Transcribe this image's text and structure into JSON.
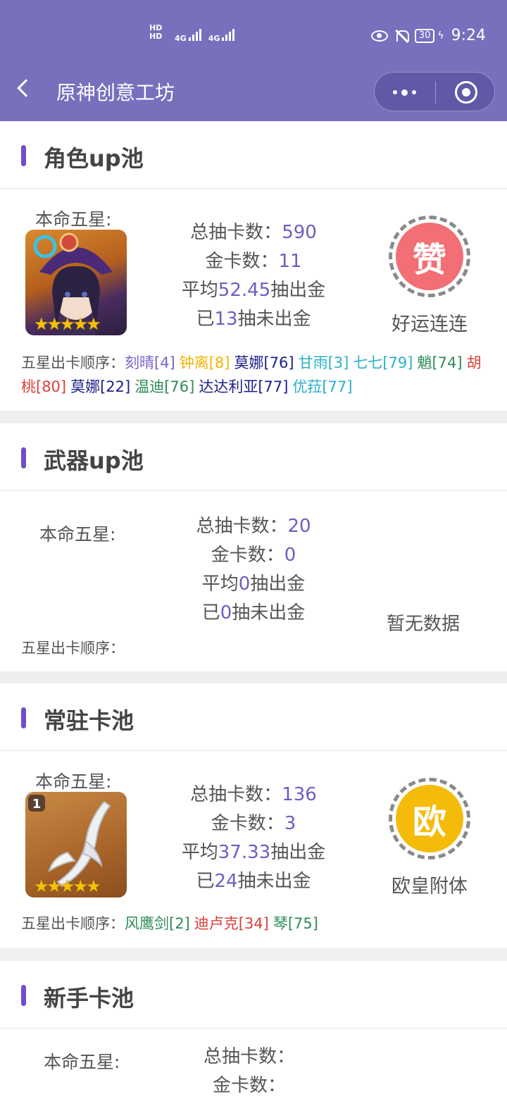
{
  "status_bar": {
    "hd1": "HD",
    "hd2": "HD",
    "net1": "4G",
    "net2": "4G",
    "battery": "30",
    "time": "9:24"
  },
  "nav": {
    "title": "原神创意工坊"
  },
  "labels": {
    "benming": "本命五星:",
    "total_prefix": "总抽卡数：",
    "gold_prefix": "金卡数：",
    "avg_prefix": "平均",
    "avg_suffix": "抽出金",
    "since_prefix": "已",
    "since_suffix": "抽未出金",
    "order_prefix": "五星出卡顺序："
  },
  "pools": [
    {
      "title": "角色up池",
      "total": "590",
      "gold": "11",
      "avg": "52.45",
      "since": "13",
      "badge_char": "赞",
      "badge_color": "#f26f75",
      "badge_caption": "好运连连",
      "order": [
        {
          "text": "刻晴[4]",
          "color": "#7b64c8"
        },
        {
          "text": "钟离[8]",
          "color": "#f0b400"
        },
        {
          "text": "莫娜[76]",
          "color": "#1c1f8a"
        },
        {
          "text": "甘雨[3]",
          "color": "#27b0c8"
        },
        {
          "text": "七七[79]",
          "color": "#27b0c8"
        },
        {
          "text": "魈[74]",
          "color": "#2e8b57"
        },
        {
          "text": "胡桃[80]",
          "color": "#d9403a"
        },
        {
          "text": "莫娜[22]",
          "color": "#1c1f8a"
        },
        {
          "text": "温迪[76]",
          "color": "#2e8b57"
        },
        {
          "text": "达达利亚[77]",
          "color": "#1c1f8a"
        },
        {
          "text": "优菈[77]",
          "color": "#27b0c8"
        }
      ]
    },
    {
      "title": "武器up池",
      "total": "20",
      "gold": "0",
      "avg": "0",
      "since": "0",
      "no_data": "暂无数据"
    },
    {
      "title": "常驻卡池",
      "total": "136",
      "gold": "3",
      "avg": "37.33",
      "since": "24",
      "badge_char": "欧",
      "badge_color": "#f5bb0b",
      "badge_caption": "欧皇附体",
      "order": [
        {
          "text": "风鹰剑[2]",
          "color": "#2e8b57"
        },
        {
          "text": "迪卢克[34]",
          "color": "#d9403a"
        },
        {
          "text": "琴[75]",
          "color": "#2e8b57"
        }
      ],
      "weapon_badge": "1"
    },
    {
      "title": "新手卡池",
      "total_label": "总抽卡数：",
      "gold_label": "金卡数："
    }
  ]
}
